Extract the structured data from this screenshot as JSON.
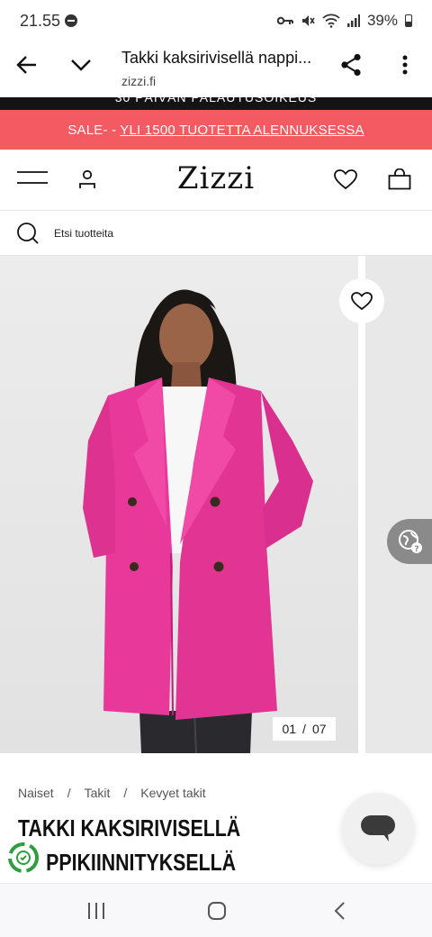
{
  "status_bar": {
    "time": "21.55",
    "battery": "39%"
  },
  "browser": {
    "title": "Takki kaksirivisellä nappi...",
    "url": "zizzi.fi"
  },
  "promo_black": {
    "text": "30 PÄIVÄN PALAUTUSOIKEUS"
  },
  "sale_banner": {
    "prefix": "SALE- -",
    "link": "YLI 1500 TUOTETTA ALENNUKSESSA"
  },
  "header": {
    "logo": "Zizzi"
  },
  "search": {
    "placeholder": "Etsi tuotteita"
  },
  "gallery": {
    "current": "01",
    "separator": "/",
    "total": "07"
  },
  "breadcrumb": {
    "items": [
      "Naiset",
      "Takit",
      "Kevyet takit"
    ],
    "separator": "/"
  },
  "product": {
    "title_line1": "TAKKI KAKSIRIVISELLÄ",
    "title_line2": "PPIKIINNITYKSELLÄ"
  },
  "colors": {
    "sale": "#f35a62",
    "coat": "#e8389a"
  }
}
